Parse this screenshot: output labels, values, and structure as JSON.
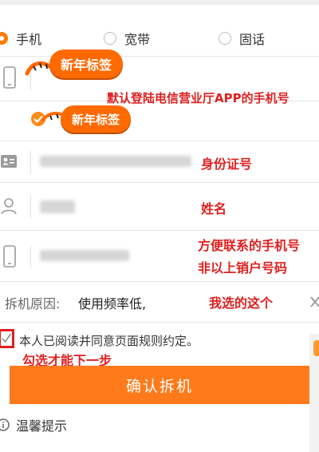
{
  "radio_options": [
    {
      "label": "手机",
      "checked": true
    },
    {
      "label": "宽带",
      "checked": false
    },
    {
      "label": "固话",
      "checked": false
    }
  ],
  "annotations": {
    "new_year_tag_1": "新年标签",
    "new_year_tag_2": "新年标签",
    "default_phone_note": "默认登陆电信营业厅APP的手机号",
    "id_card_note": "身份证号",
    "name_note": "姓名",
    "contact_note_line1": "方便联系的手机号",
    "contact_note_line2": "非以上销户号码",
    "reason_note": "我选的这个",
    "checkbox_note": "勾选才能下一步"
  },
  "form": {
    "reason_label": "拆机原因:",
    "reason_value": "使用频率低,",
    "agree_text": "本人已阅读并同意页面规则约定。"
  },
  "confirm_button_label": "确认拆机",
  "tips_label": "温馨提示",
  "colors": {
    "accent": "#ff7a1a",
    "annotation_red": "#e02020"
  }
}
